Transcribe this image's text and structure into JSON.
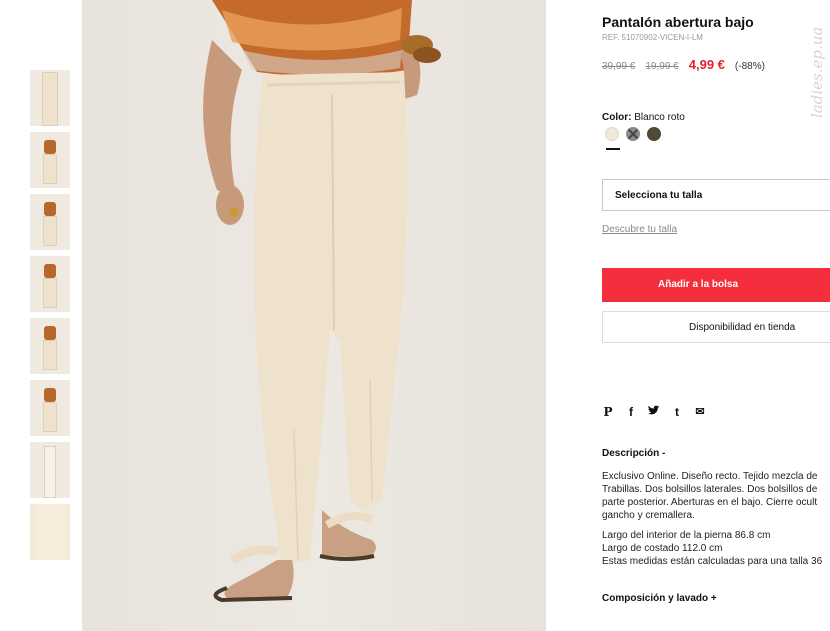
{
  "product": {
    "title": "Pantalón abertura bajo",
    "ref": "REF. 51070902-VICEN-I-LM",
    "price_original": "39,99 €",
    "price_previous": "19,99 €",
    "price_current": "4,99 €",
    "discount": "(-88%)"
  },
  "watermark": "ladies.ep.ua",
  "color": {
    "label": "Color:",
    "value": "Blanco roto",
    "swatches": [
      {
        "name": "Blanco roto",
        "hex": "#f1e8d8",
        "selected": true
      },
      {
        "name": "Gris",
        "hex": "#8a8a8a",
        "unavailable": true
      },
      {
        "name": "Kaki",
        "hex": "#4f4a35"
      }
    ]
  },
  "size": {
    "select_label": "Selecciona tu talla",
    "guide_link": "Descubre tu talla"
  },
  "actions": {
    "add_to_bag": "Añadir a la bolsa",
    "store_availability": "Disponibilidad en tienda"
  },
  "share_icons": {
    "pinterest": "P",
    "facebook": "f",
    "twitter": "t",
    "tumblr": "t",
    "email": "✉"
  },
  "description": {
    "title": "Descripción -",
    "lines": [
      "Exclusivo Online. Diseño recto. Tejido mezcla de",
      "Trabillas. Dos bolsillos laterales. Dos bolsillos de",
      "parte posterior. Aberturas en el bajo. Cierre ocult",
      "gancho y cremallera."
    ],
    "measures": [
      "Largo del interior de la pierna 86.8 cm",
      "Largo de costado 112.0 cm",
      "Estas medidas están calculadas para una talla 36"
    ]
  },
  "composition": {
    "title": "Composición y lavado +"
  },
  "colors": {
    "accent": "#f42e3c",
    "price_red": "#e3202f"
  }
}
